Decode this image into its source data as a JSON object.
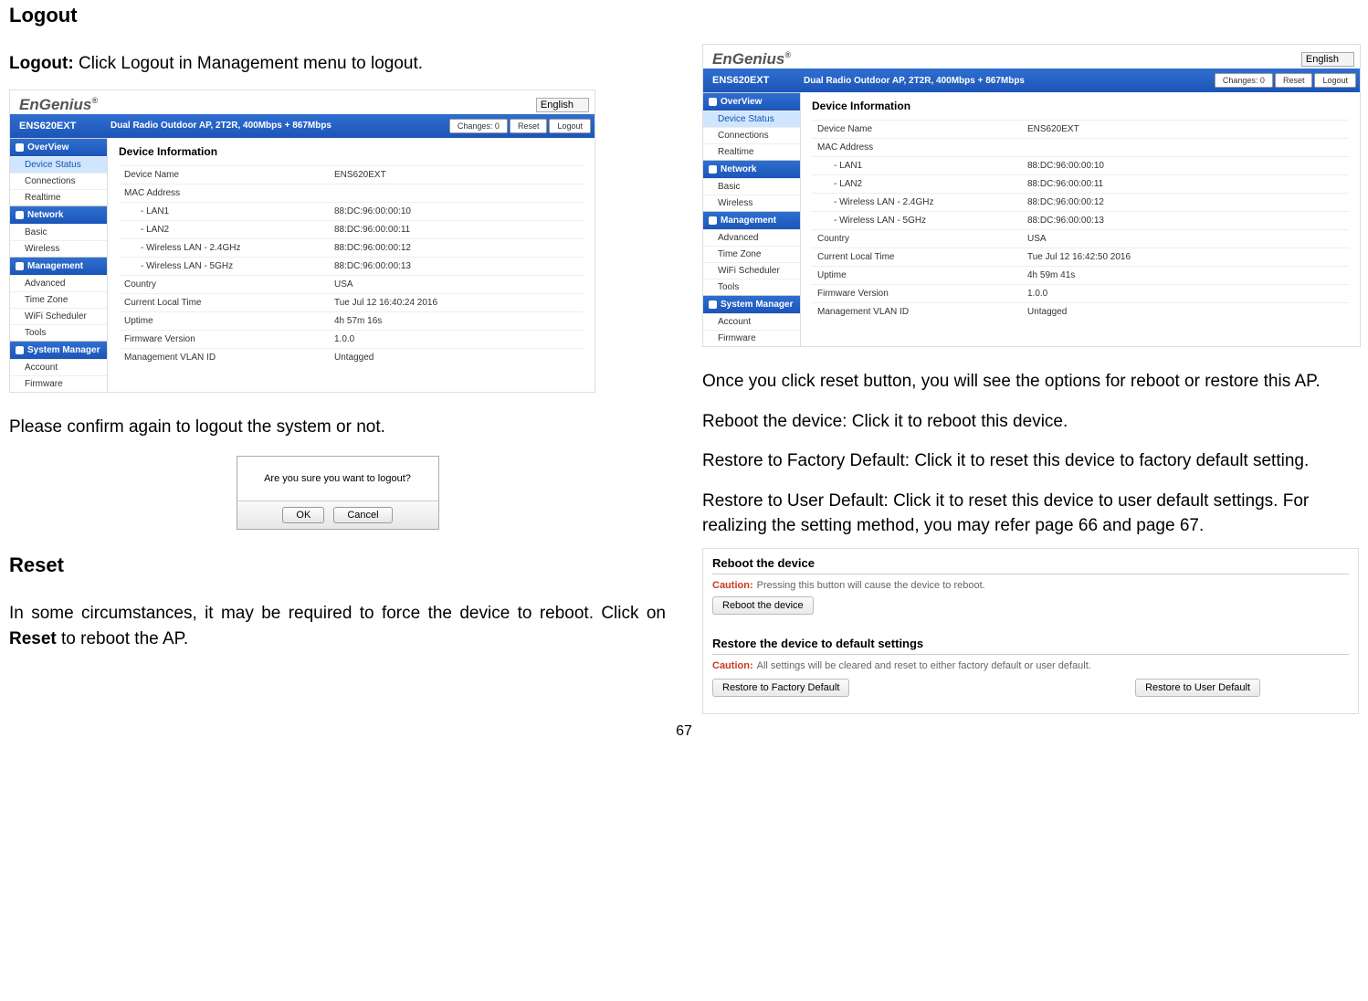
{
  "page_number": "67",
  "left": {
    "heading_logout": "Logout",
    "logout_prefix": "Logout: ",
    "logout_text": "Click Logout  in Management menu to logout.",
    "confirm_text": "Please confirm again to logout the system or not.",
    "heading_reset": "Reset",
    "reset_text_a": "In some circumstances, it may be required to force the device to reboot. Click on ",
    "reset_word": "Reset",
    "reset_text_b": " to reboot the AP."
  },
  "right": {
    "once_text": "Once you click reset button, you will see the options for reboot or restore this AP.",
    "reboot_text": "Reboot the device: Click it to reboot this device.",
    "restore_factory": "Restore to Factory Default: Click it to reset this device to factory default setting.",
    "restore_user": "Restore to User Default: Click it to reset this device to user default settings. For realizing the setting method, you may refer page 66 and page 67."
  },
  "panel1": {
    "logo": "EnGenius",
    "model": "ENS620EXT",
    "desc": "Dual Radio Outdoor AP, 2T2R, 400Mbps + 867Mbps",
    "lang": "English",
    "btn_changes": "Changes: 0",
    "btn_reset": "Reset",
    "btn_logout": "Logout",
    "section_title": "Device Information",
    "rows": {
      "device_name_k": "Device Name",
      "device_name_v": "ENS620EXT",
      "mac_k": "MAC Address",
      "lan1_k": "- LAN1",
      "lan1_v": "88:DC:96:00:00:10",
      "lan2_k": "- LAN2",
      "lan2_v": "88:DC:96:00:00:11",
      "w24_k": "- Wireless LAN - 2.4GHz",
      "w24_v": "88:DC:96:00:00:12",
      "w5_k": "- Wireless LAN - 5GHz",
      "w5_v": "88:DC:96:00:00:13",
      "country_k": "Country",
      "country_v": "USA",
      "time_k": "Current Local Time",
      "time_v": "Tue Jul 12 16:40:24 2016",
      "uptime_k": "Uptime",
      "uptime_v": "4h 57m 16s",
      "fw_k": "Firmware Version",
      "fw_v": "1.0.0",
      "vlan_k": "Management VLAN ID",
      "vlan_v": "Untagged"
    },
    "side": {
      "overview": "OverView",
      "device_status": "Device Status",
      "connections": "Connections",
      "realtime": "Realtime",
      "network": "Network",
      "basic": "Basic",
      "wireless": "Wireless",
      "management": "Management",
      "advanced": "Advanced",
      "time_zone": "Time Zone",
      "wifi_sched": "WiFi Scheduler",
      "tools": "Tools",
      "sys_mgr": "System Manager",
      "account": "Account",
      "firmware": "Firmware"
    }
  },
  "panel2_overrides": {
    "time_v": "Tue Jul 12 16:42:50 2016",
    "uptime_v": "4h 59m 41s"
  },
  "dialog": {
    "text": "Are you sure you want to logout?",
    "ok": "OK",
    "cancel": "Cancel"
  },
  "reboot_panel": {
    "sect1_title": "Reboot the device",
    "caution1_label": "Caution:",
    "caution1_text": "Pressing this button will cause the device to reboot.",
    "btn_reboot": "Reboot the device",
    "sect2_title": "Restore the device to default settings",
    "caution2_label": "Caution:",
    "caution2_text": "All settings will be cleared and reset to either factory default or user default.",
    "btn_factory": "Restore to Factory Default",
    "btn_user": "Restore to User Default"
  }
}
